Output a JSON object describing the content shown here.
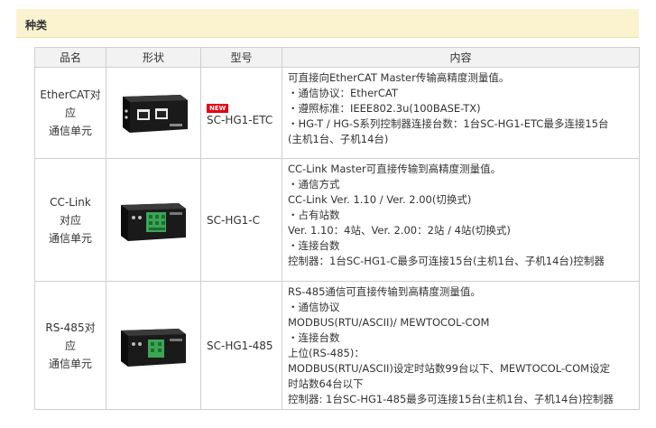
{
  "section": {
    "title": "种类"
  },
  "table": {
    "headers": {
      "name": "品名",
      "shape": "形状",
      "model": "型号",
      "content": "内容"
    },
    "rows": [
      {
        "name_lines": [
          "EtherCAT对",
          "应",
          "通信单元"
        ],
        "image": "ethercat-unit-image",
        "badge": "NEW",
        "model": "SC-HG1-ETC",
        "content_lines": [
          "可直接向EtherCAT Master传输高精度测量值。",
          "・通信协议：EtherCAT",
          "・遵照标准：IEEE802.3u(100BASE-TX)",
          "・HG-T / HG-S系列控制器连接台数：1台SC-HG1-ETC最多连接15台",
          "(主机1台、子机14台)"
        ]
      },
      {
        "name_lines": [
          "CC-Link",
          "对应",
          "通信单元"
        ],
        "image": "cc-link-unit-image",
        "badge": "",
        "model": "SC-HG1-C",
        "content_lines": [
          "CC-Link Master可直接传输到高精度测量值。",
          "・通信方式",
          "CC-Link Ver. 1.10 / Ver. 2.00(切换式)",
          "・占有站数",
          "Ver. 1.10：4站、Ver. 2.00：2站 / 4站(切换式)",
          "・连接台数",
          "控制器：1台SC-HG1-C最多可连接15台(主机1台、子机14台)控制器"
        ]
      },
      {
        "name_lines": [
          "RS-485对",
          "应",
          "通信单元"
        ],
        "image": "rs485-unit-image",
        "badge": "",
        "model": "SC-HG1-485",
        "content_lines": [
          "RS-485通信可直接传输到高精度测量值。",
          "・通信协议",
          "MODBUS(RTU/ASCII)/ MEWTOCOL-COM",
          "・连接台数",
          "上位(RS-485)：",
          "MODBUS(RTU/ASCII)设定时站数99台以下、MEWTOCOL-COM设定",
          "时站数64台以下",
          "控制器: 1台SC-HG1-485最多可连接15台(主机1台、子机14台)控制器"
        ]
      }
    ]
  },
  "colors": {
    "header_band": "#fbf3d0",
    "table_header": "#f2f2f2",
    "new_badge": "#e60012",
    "terminal_green": "#3aa655"
  }
}
